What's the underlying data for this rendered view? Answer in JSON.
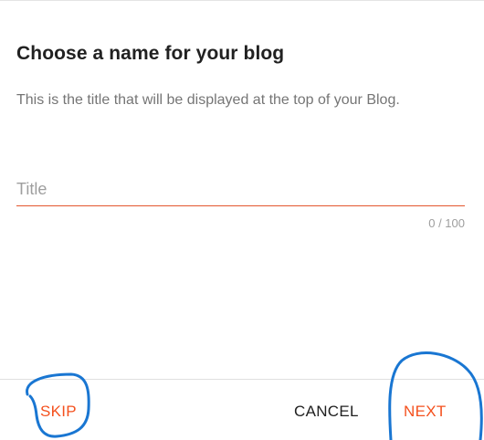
{
  "dialog": {
    "title": "Choose a name for your blog",
    "description": "This is the title that will be displayed at the top of your Blog.",
    "title_field": {
      "placeholder": "Title",
      "value": ""
    },
    "counter": "0 / 100"
  },
  "footer": {
    "skip_label": "SKIP",
    "cancel_label": "CANCEL",
    "next_label": "NEXT"
  },
  "colors": {
    "accent": "#f4511e",
    "annotation": "#1976d2"
  }
}
